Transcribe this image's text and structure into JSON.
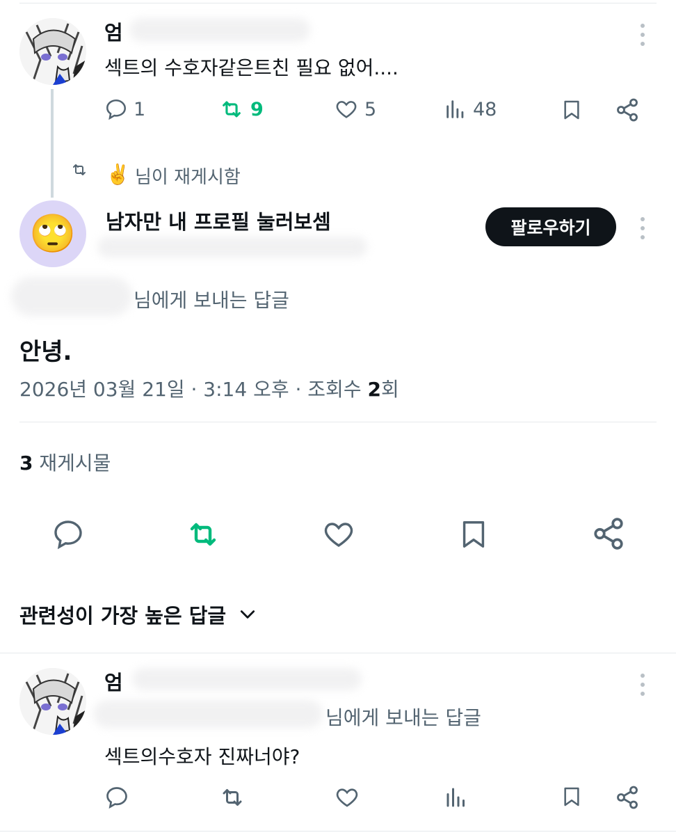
{
  "quoted_post": {
    "author_name": "엄",
    "text": "섹트의 수호자같은트친 필요 없어....",
    "stats": {
      "replies": "1",
      "reposts": "9",
      "likes": "5",
      "views": "48"
    }
  },
  "repost_banner": {
    "emoji": "✌️",
    "text": "님이 재게시함"
  },
  "main_post": {
    "author_name": "남자만 내 프로필 눌러보셈",
    "follow_label": "팔로우하기",
    "reply_to_text": "님에게 보내는 답글",
    "body": "안녕.",
    "meta_date": "2026년 03월 21일 · 3:14 오후 · 조회수 ",
    "meta_views": "2",
    "meta_views_unit": "회",
    "repost_count": "3",
    "repost_label": " 재게시물",
    "avatar_emoji": "🙄"
  },
  "sort": {
    "label": "관련성이 가장 높은 답글"
  },
  "reply_post": {
    "author_name": "엄",
    "reply_to_text": "님에게 보내는 답글",
    "text": "섹트의수호자 진짜너야?"
  },
  "colors": {
    "accent_green": "#00ba7c",
    "muted": "#536471",
    "button_bg": "#0f1419"
  }
}
